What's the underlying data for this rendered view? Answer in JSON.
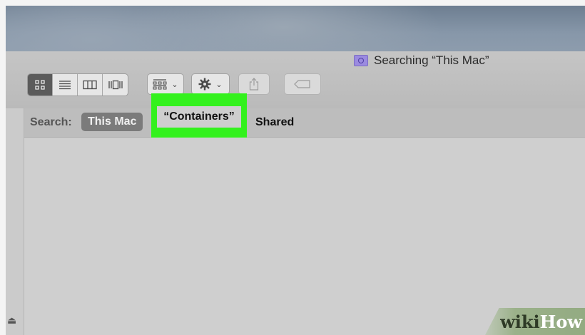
{
  "window": {
    "title": "Searching “This Mac”",
    "title_icon": "search-folder-icon"
  },
  "toolbar": {
    "view_buttons": [
      {
        "icon": "icon-view-icon",
        "active": true
      },
      {
        "icon": "list-view-icon",
        "active": false
      },
      {
        "icon": "column-view-icon",
        "active": false
      },
      {
        "icon": "cover-flow-icon",
        "active": false
      }
    ],
    "group_button_icon": "group-by-icon",
    "action_button_icon": "gear-icon",
    "share_button_icon": "share-icon",
    "tag_button_icon": "tag-icon"
  },
  "search_scope": {
    "label": "Search:",
    "options": [
      "This Mac",
      "“Containers”",
      "Shared"
    ],
    "selected": "This Mac",
    "highlighted": "“Containers”"
  },
  "colors": {
    "highlight": "#33f11d",
    "selected_scope": "#7b7b7b"
  },
  "watermark": {
    "part1": "wiki",
    "part2": "How"
  }
}
